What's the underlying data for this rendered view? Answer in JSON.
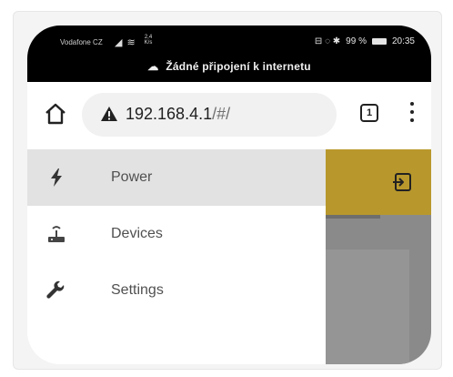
{
  "status_bar": {
    "carrier": "Vodafone CZ",
    "net_speed_value": "2,4",
    "net_speed_unit": "K/s",
    "status_icons": "⊟ ◌ ✱",
    "battery": "99 %",
    "time": "20:35"
  },
  "offline_banner": {
    "text": "Žádné připojení k internetu"
  },
  "browser": {
    "url_host": "192.168.4.1",
    "url_path": "/#/",
    "tab_count": "1"
  },
  "drawer": {
    "items": [
      {
        "label": "Power",
        "icon": "bolt-icon",
        "active": true
      },
      {
        "label": "Devices",
        "icon": "router-icon",
        "active": false
      },
      {
        "label": "Settings",
        "icon": "wrench-icon",
        "active": false
      }
    ]
  },
  "colors": {
    "header_accent": "#b8982c",
    "drawer_active_bg": "#e2e2e2",
    "scrim": "#8a8a8a"
  }
}
